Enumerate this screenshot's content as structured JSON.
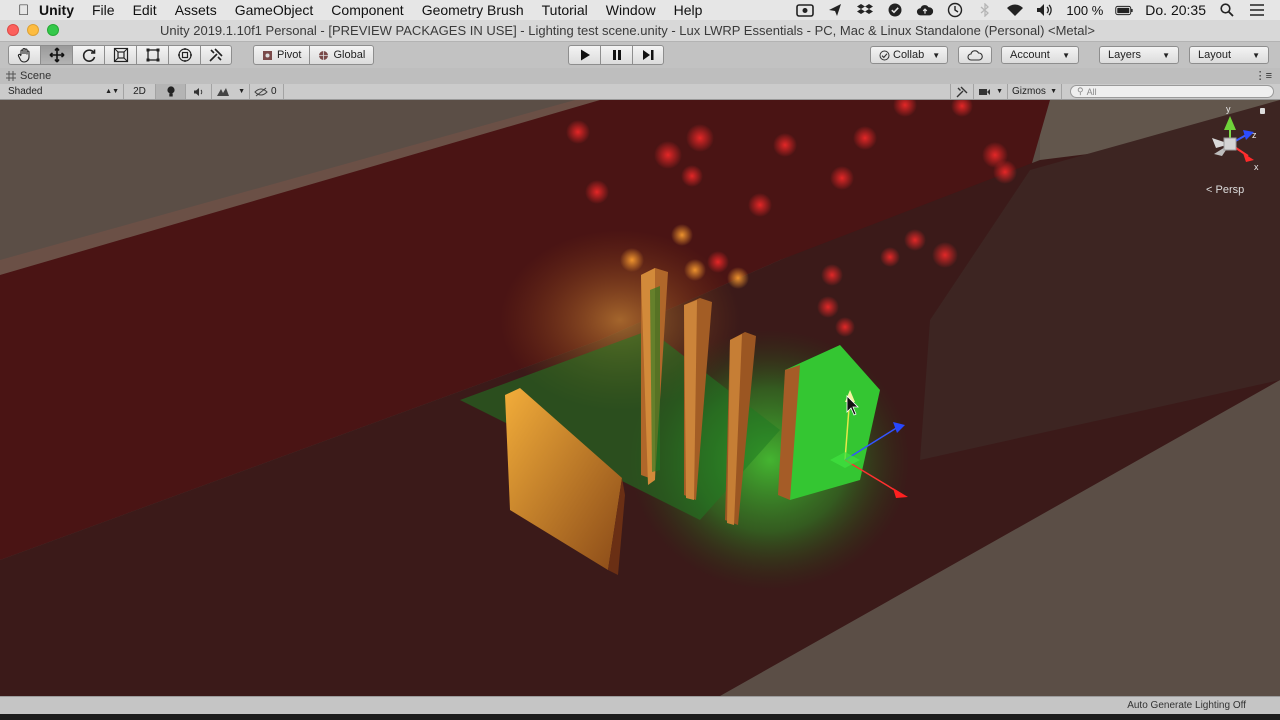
{
  "menubar": {
    "apple_icon": "apple-logo-icon",
    "items": [
      "Unity",
      "File",
      "Edit",
      "Assets",
      "GameObject",
      "Component",
      "Geometry Brush",
      "Tutorial",
      "Window",
      "Help"
    ],
    "battery": "100 %",
    "clock": "Do. 20:35",
    "status_icons": [
      "screen-record-icon",
      "kite-icon",
      "dropbox-icon",
      "check-circle-icon",
      "cloud-icon",
      "time-machine-icon",
      "bluetooth-icon",
      "wifi-icon",
      "volume-icon"
    ]
  },
  "window": {
    "title": "Unity 2019.1.10f1 Personal - [PREVIEW PACKAGES IN USE] - Lighting test scene.unity - Lux LWRP Essentials - PC, Mac & Linux Standalone (Personal) <Metal>"
  },
  "toolbar": {
    "tools": [
      "hand-tool-icon",
      "move-tool-icon",
      "rotate-tool-icon",
      "scale-tool-icon",
      "rect-tool-icon",
      "transform-tool-icon",
      "custom-tool-icon"
    ],
    "pivot_label": "Pivot",
    "global_label": "Global",
    "collab_label": "Collab",
    "account_label": "Account",
    "layers_label": "Layers",
    "layout_label": "Layout"
  },
  "scene": {
    "tab_label": "Scene",
    "shading_mode": "Shaded",
    "mode_2d": "2D",
    "effects_count": "0",
    "gizmos_label": "Gizmos",
    "search_placeholder": "All",
    "persp_label": "Persp",
    "axis_y": "y",
    "axis_z": "z",
    "axis_x": "x"
  },
  "status": {
    "text": "Auto Generate Lighting Off"
  },
  "colors": {
    "floor": "#3a1a18",
    "wall": "#4a1212",
    "ground": "#5a4d45",
    "accent_green": "#38d23a",
    "accent_orange": "#f2a93a"
  }
}
